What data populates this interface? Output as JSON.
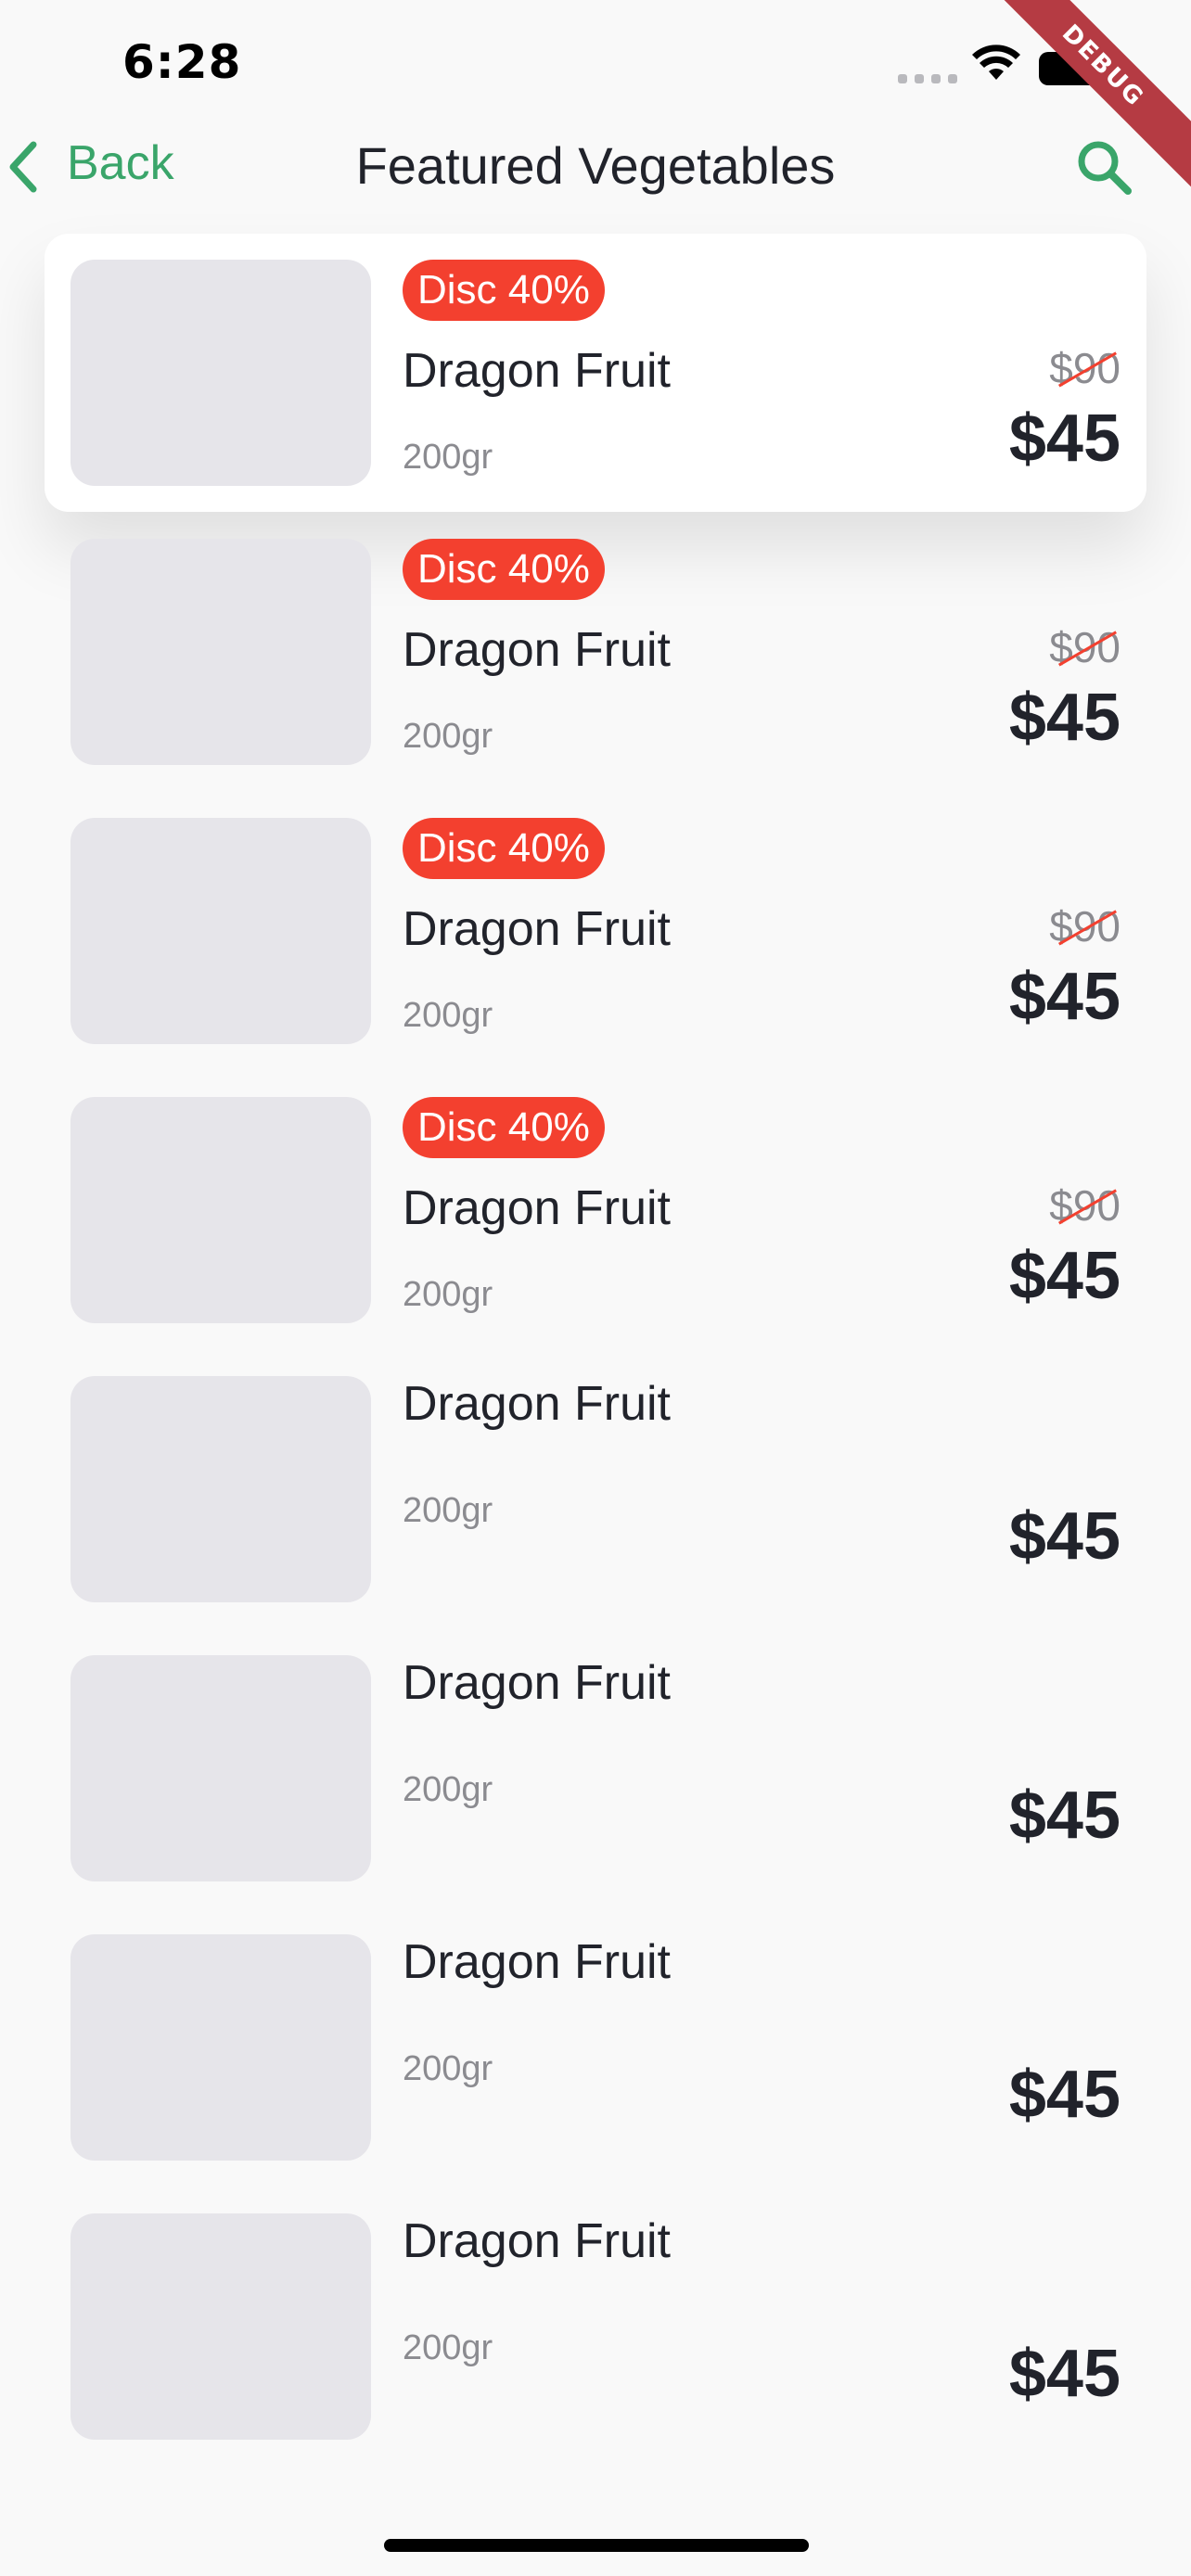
{
  "status_bar": {
    "time": "6:28"
  },
  "debug_banner": "DEBUG",
  "nav": {
    "back_label": "Back",
    "title": "Featured Vegetables",
    "search_icon": "search-icon"
  },
  "colors": {
    "accent": "#3aa56a",
    "discount": "#f3402f",
    "image_placeholder": "#e6e5ea"
  },
  "products": [
    {
      "discount": "Disc 40%",
      "name": "Dragon Fruit",
      "weight": "200gr",
      "old_price": "$90",
      "price": "$45",
      "selected": true
    },
    {
      "discount": "Disc 40%",
      "name": "Dragon Fruit",
      "weight": "200gr",
      "old_price": "$90",
      "price": "$45"
    },
    {
      "discount": "Disc 40%",
      "name": "Dragon Fruit",
      "weight": "200gr",
      "old_price": "$90",
      "price": "$45"
    },
    {
      "discount": "Disc 40%",
      "name": "Dragon Fruit",
      "weight": "200gr",
      "old_price": "$90",
      "price": "$45"
    },
    {
      "name": "Dragon Fruit",
      "weight": "200gr",
      "price": "$45"
    },
    {
      "name": "Dragon Fruit",
      "weight": "200gr",
      "price": "$45"
    },
    {
      "name": "Dragon Fruit",
      "weight": "200gr",
      "price": "$45"
    },
    {
      "name": "Dragon Fruit",
      "weight": "200gr",
      "price": "$45"
    }
  ]
}
